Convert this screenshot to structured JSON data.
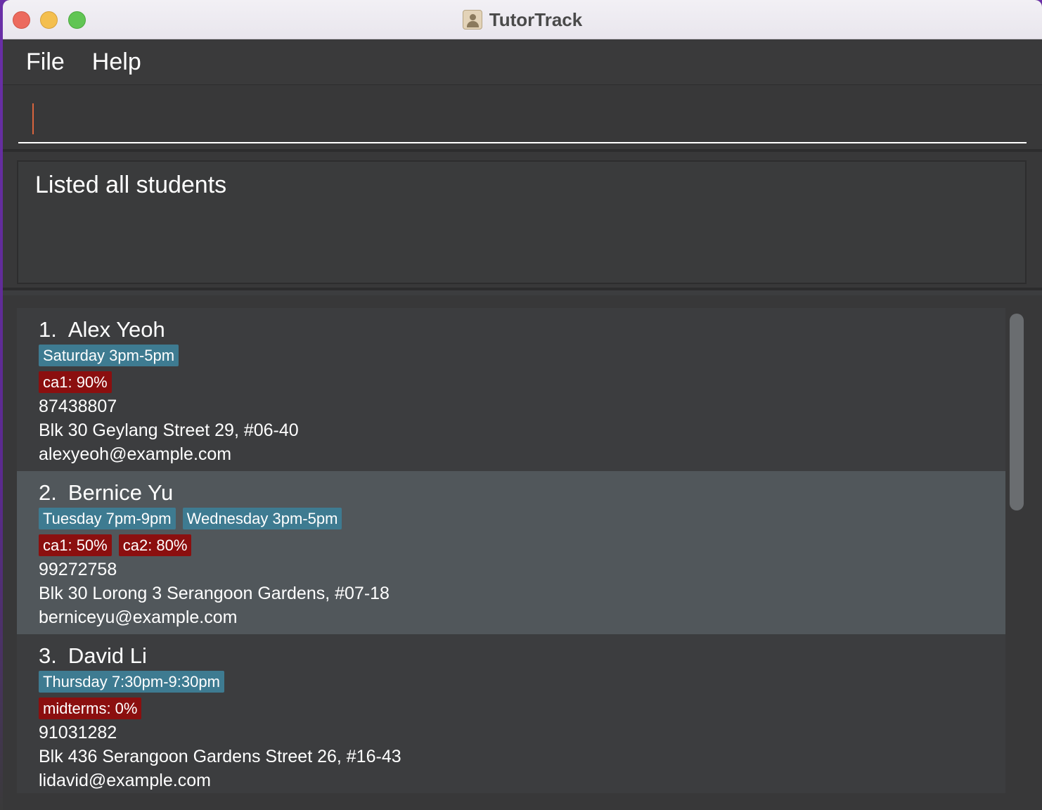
{
  "window": {
    "title": "TutorTrack",
    "app_icon": "address-book-icon"
  },
  "menu": {
    "items": [
      "File",
      "Help"
    ]
  },
  "command": {
    "value": ""
  },
  "result": {
    "message": "Listed all students"
  },
  "students": [
    {
      "index": "1.",
      "name": "Alex Yeoh",
      "times": [
        "Saturday 3pm-5pm"
      ],
      "grades": [
        "ca1: 90%"
      ],
      "phone": "87438807",
      "address": "Blk 30 Geylang Street 29, #06-40",
      "email": "alexyeoh@example.com",
      "selected": false
    },
    {
      "index": "2.",
      "name": "Bernice Yu",
      "times": [
        "Tuesday 7pm-9pm",
        "Wednesday 3pm-5pm"
      ],
      "grades": [
        "ca1: 50%",
        "ca2: 80%"
      ],
      "phone": "99272758",
      "address": "Blk 30 Lorong 3 Serangoon Gardens, #07-18",
      "email": "berniceyu@example.com",
      "selected": true
    },
    {
      "index": "3.",
      "name": "David Li",
      "times": [
        "Thursday 7:30pm-9:30pm"
      ],
      "grades": [
        "midterms: 0%"
      ],
      "phone": "91031282",
      "address": "Blk 436 Serangoon Gardens Street 26, #16-43",
      "email": "lidavid@example.com",
      "selected": false
    }
  ],
  "colors": {
    "time_tag": "#3e7b91",
    "grade_tag": "#8b0f0f",
    "selected_card": "#51575b",
    "caret": "#d8643e"
  }
}
